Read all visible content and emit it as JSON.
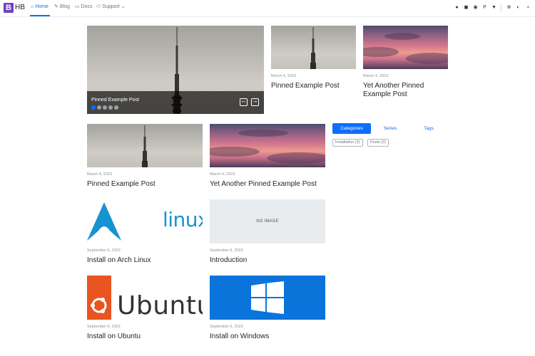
{
  "brand": {
    "logo_letter": "B",
    "name": "HB"
  },
  "nav": {
    "items": [
      {
        "label": "Home",
        "icon": "home-icon",
        "active": true
      },
      {
        "label": "Blog",
        "icon": "blog-icon",
        "active": false
      },
      {
        "label": "Docs",
        "icon": "book-icon",
        "active": false
      },
      {
        "label": "Support",
        "icon": "support-icon",
        "active": false
      }
    ],
    "right_icons": [
      "github-icon",
      "mastodon-icon",
      "discord-icon",
      "paypal-icon",
      "patreon-icon",
      "twitter-icon",
      "language-icon",
      "theme-toggle-icon",
      "search-icon"
    ]
  },
  "carousel": {
    "title": "Pinned Example Post",
    "slide_count": 5,
    "active_slide": 1,
    "prev_glyph": "⇽",
    "next_glyph": "⇾"
  },
  "featured": [
    {
      "date": "March 4, 2023",
      "title": "Pinned Example Post"
    },
    {
      "date": "March 4, 2023",
      "title": "Yet Another Pinned Example Post"
    }
  ],
  "posts": [
    {
      "date": "March 4, 2023",
      "title": "Pinned Example Post"
    },
    {
      "date": "March 4, 2023",
      "title": "Yet Another Pinned Example Post"
    },
    {
      "date": "September 6, 2022",
      "title": "Install on Arch Linux",
      "image_text": "linux"
    },
    {
      "date": "September 6, 2022",
      "title": "Introduction",
      "image_text": "NO IMAGE"
    },
    {
      "date": "September 6, 2022",
      "title": "Install on Ubuntu",
      "image_text": "Ubuntu"
    },
    {
      "date": "September 6, 2022",
      "title": "Install on Windows"
    }
  ],
  "taxonomy": {
    "tabs": [
      {
        "label": "Categories",
        "active": true
      },
      {
        "label": "Series",
        "active": false
      },
      {
        "label": "Tags",
        "active": false
      }
    ],
    "badges": [
      "Installation (3)",
      "Posts (2)"
    ]
  },
  "colors": {
    "accent": "#0d6efd",
    "brand": "#6f42c1",
    "arch_blue": "#1793d1",
    "ubuntu_orange": "#e95420",
    "windows_blue": "#0a74da"
  }
}
